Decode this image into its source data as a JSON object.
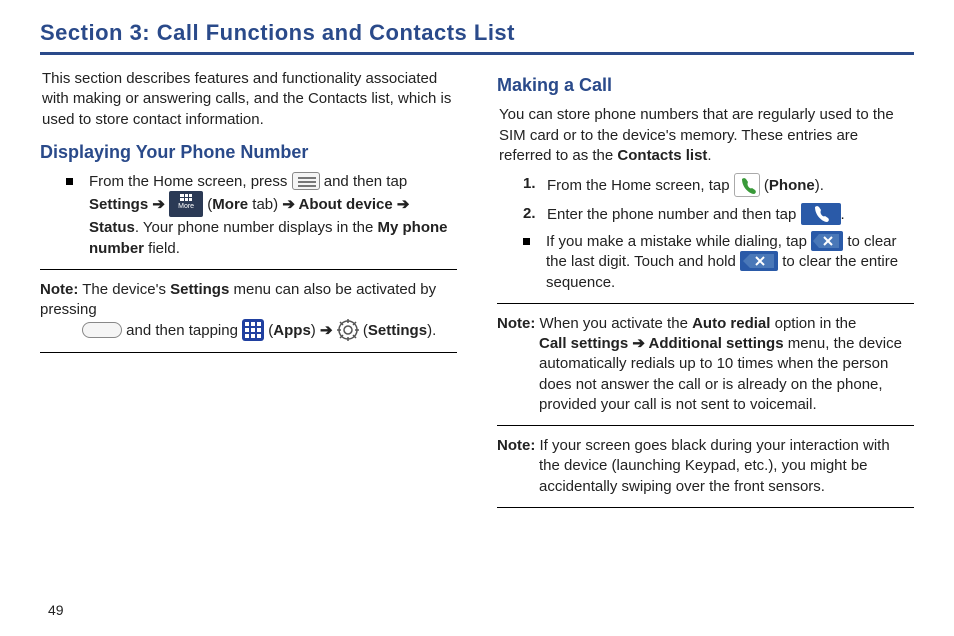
{
  "page_number": "49",
  "section_title": "Section 3: Call Functions and Contacts List",
  "left": {
    "intro": "This section describes features and functionality associated with making or answering calls, and the Contacts list, which is used to store contact information.",
    "subhead": "Displaying Your Phone Number",
    "step": {
      "p1": "From the Home screen, press ",
      "p2": " and then tap ",
      "b_settings": "Settings",
      "arrow": " ➔ ",
      "p3": " (",
      "b_more": "More",
      "p4": " tab) ",
      "b_about": "About device",
      "b_status": "Status",
      "p5": ". Your phone number displays in the ",
      "b_field": "My phone number",
      "p6": " field."
    },
    "note": {
      "label": "Note:",
      "p1": " The device's ",
      "b_settings": "Settings",
      "p2": " menu can also be activated by pressing ",
      "p3": " and then tapping ",
      "b_apps": "Apps",
      "arrow": " ➔ ",
      "b_settings2": "Settings",
      "p4": "."
    }
  },
  "right": {
    "subhead": "Making a Call",
    "intro_p1": "You can store phone numbers that are regularly used to the SIM card or to the device's memory. These entries are referred to as the ",
    "intro_b": "Contacts list",
    "intro_p2": ".",
    "step1": {
      "num": "1.",
      "p1": "From the Home screen, tap ",
      "p2": " (",
      "b_phone": "Phone",
      "p3": ")."
    },
    "step2": {
      "num": "2.",
      "p1": "Enter the phone number and then tap ",
      "p2": "."
    },
    "bullet": {
      "p1": "If you make a mistake while dialing, tap ",
      "p2": " to clear the last digit. Touch and hold ",
      "p3": " to clear the entire sequence."
    },
    "note1": {
      "label": "Note:",
      "p1": " When you activate the ",
      "b_auto": "Auto redial",
      "p2": " option in the ",
      "b_call": "Call settings",
      "arrow": " ➔ ",
      "b_add": "Additional settings",
      "p3": " menu, the device automatically redials up to 10 times when the person does not answer the call or is already on the phone, provided your call is not sent to voicemail."
    },
    "note2": {
      "label": "Note:",
      "p1": " If your screen goes black during your interaction with the device (launching Keypad, etc.), you might be accidentally swiping over the front sensors."
    }
  }
}
